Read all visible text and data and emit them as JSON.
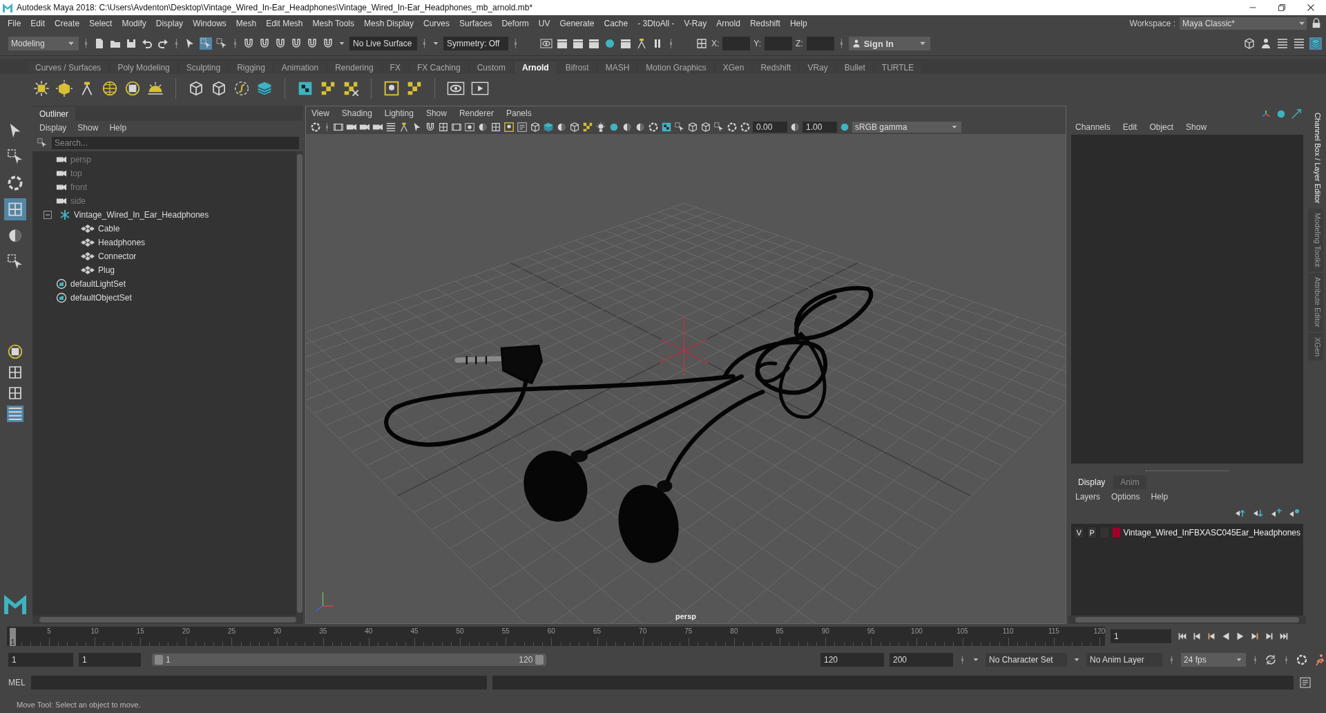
{
  "title_bar": {
    "title": "Autodesk Maya 2018: C:\\Users\\Avdenton\\Desktop\\Vintage_Wired_In-Ear_Headphones\\Vintage_Wired_In-Ear_Headphones_mb_arnold.mb*"
  },
  "menu_bar": [
    "File",
    "Edit",
    "Create",
    "Select",
    "Modify",
    "Display",
    "Windows",
    "Mesh",
    "Edit Mesh",
    "Mesh Tools",
    "Mesh Display",
    "Curves",
    "Surfaces",
    "Deform",
    "UV",
    "Generate",
    "Cache",
    "- 3DtoAll -",
    "V-Ray",
    "Arnold",
    "Redshift",
    "Help"
  ],
  "workspace": {
    "label": "Workspace :",
    "value": "Maya Classic*"
  },
  "status_line": {
    "mode": "Modeling",
    "live_surface": "No Live Surface",
    "symmetry": "Symmetry: Off",
    "x_label": "X:",
    "y_label": "Y:",
    "z_label": "Z:",
    "sign_in": "Sign In"
  },
  "shelf_tabs": [
    {
      "label": "Curves / Surfaces",
      "selected": false
    },
    {
      "label": "Poly Modeling",
      "selected": false
    },
    {
      "label": "Sculpting",
      "selected": false
    },
    {
      "label": "Rigging",
      "selected": false
    },
    {
      "label": "Animation",
      "selected": false
    },
    {
      "label": "Rendering",
      "selected": false
    },
    {
      "label": "FX",
      "selected": false
    },
    {
      "label": "FX Caching",
      "selected": false
    },
    {
      "label": "Custom",
      "selected": false
    },
    {
      "label": "Arnold",
      "selected": true
    },
    {
      "label": "Bifrost",
      "selected": false
    },
    {
      "label": "MASH",
      "selected": false
    },
    {
      "label": "Motion Graphics",
      "selected": false
    },
    {
      "label": "XGen",
      "selected": false
    },
    {
      "label": "Redshift",
      "selected": false
    },
    {
      "label": "VRay",
      "selected": false
    },
    {
      "label": "Bullet",
      "selected": false
    },
    {
      "label": "TURTLE",
      "selected": false
    }
  ],
  "toolbox": {
    "tools": [
      {
        "selected": false
      },
      {
        "selected": false
      },
      {
        "selected": false
      },
      {
        "selected": true
      },
      {
        "selected": false
      },
      {
        "selected": false
      }
    ]
  },
  "outliner": {
    "title": "Outliner",
    "menu": [
      "Display",
      "Show",
      "Help"
    ],
    "search_placeholder": "Search...",
    "items": [
      {
        "label": "persp",
        "kind": "camera",
        "dimmed": true
      },
      {
        "label": "top",
        "kind": "camera",
        "dimmed": true
      },
      {
        "label": "front",
        "kind": "camera",
        "dimmed": true
      },
      {
        "label": "side",
        "kind": "camera",
        "dimmed": true
      },
      {
        "label": "Vintage_Wired_In_Ear_Headphones",
        "kind": "group",
        "dimmed": false,
        "expanded": true,
        "children": [
          {
            "label": "Cable",
            "kind": "mesh",
            "dimmed": false
          },
          {
            "label": "Headphones",
            "kind": "mesh",
            "dimmed": false
          },
          {
            "label": "Connector",
            "kind": "mesh",
            "dimmed": false
          },
          {
            "label": "Plug",
            "kind": "mesh",
            "dimmed": false
          }
        ]
      },
      {
        "label": "defaultLightSet",
        "kind": "set",
        "dimmed": false
      },
      {
        "label": "defaultObjectSet",
        "kind": "set",
        "dimmed": false
      }
    ]
  },
  "viewport": {
    "menu": [
      "View",
      "Shading",
      "Lighting",
      "Show",
      "Renderer",
      "Panels"
    ],
    "exposure": "0.00",
    "gamma": "1.00",
    "color_space": "sRGB gamma",
    "camera_label": "persp"
  },
  "channel_box": {
    "menu": [
      "Channels",
      "Edit",
      "Object",
      "Show"
    ]
  },
  "layer_editor": {
    "tabs": [
      {
        "label": "Display",
        "selected": true
      },
      {
        "label": "Anim",
        "selected": false
      }
    ],
    "menu": [
      "Layers",
      "Options",
      "Help"
    ],
    "layers": [
      {
        "visibility": "V",
        "playback": "P",
        "name": "Vintage_Wired_InFBXASC045Ear_Headphones",
        "color": "#a0002a"
      }
    ]
  },
  "side_tabs": [
    {
      "label": "Channel Box / Layer Editor",
      "selected": true
    },
    {
      "label": "Modeling Toolkit",
      "selected": false
    },
    {
      "label": "Attribute Editor",
      "selected": false
    },
    {
      "label": "XGen",
      "selected": false
    }
  ],
  "timeline": {
    "current_frame": "1",
    "level": 0,
    "ticks": [
      "5",
      "10",
      "15",
      "20",
      "25",
      "30",
      "35",
      "40",
      "45",
      "50",
      "55",
      "60",
      "65",
      "70",
      "75",
      "80",
      "85",
      "90",
      "95",
      "100",
      "105",
      "110",
      "115",
      "120"
    ],
    "frame_field": "1"
  },
  "range": {
    "level": 1,
    "start": "1",
    "playback_start": "1",
    "slider_start": "1",
    "slider_end": "120",
    "playback_end": "120",
    "end": "200",
    "character_set": "No Character Set",
    "anim_layer": "No Anim Layer",
    "fps": "24 fps"
  },
  "command_line": {
    "label": "MEL"
  },
  "help_line": "Move Tool: Select an object to move."
}
